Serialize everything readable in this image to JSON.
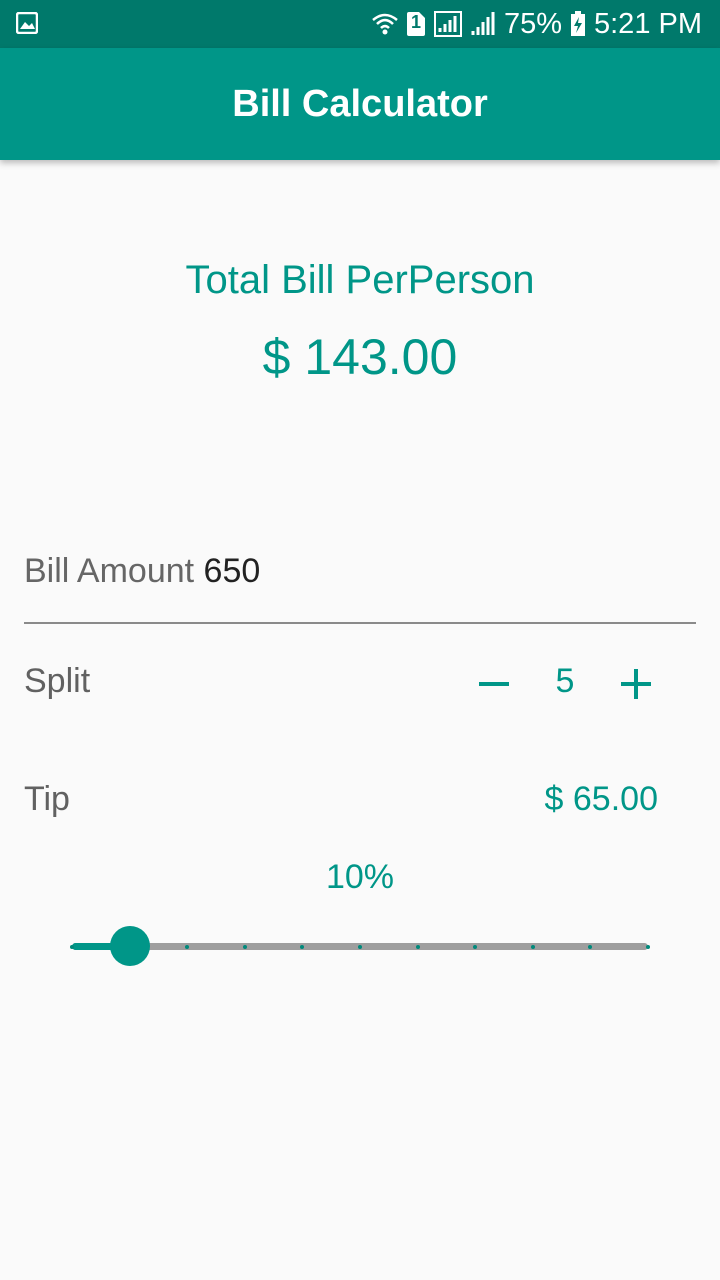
{
  "status_bar": {
    "battery_percent": "75%",
    "time": "5:21 PM",
    "sim_label": "1",
    "icons": [
      "gallery-notification-icon",
      "wifi-icon",
      "sim-icon",
      "signal-icon",
      "signal-icon",
      "battery-charging-icon"
    ]
  },
  "app_bar": {
    "title": "Bill Calculator"
  },
  "total": {
    "label": "Total Bill PerPerson",
    "value": "$ 143.00"
  },
  "bill": {
    "label": "Bill Amount",
    "value": "650"
  },
  "split": {
    "label": "Split",
    "value": "5",
    "decrement_icon": "minus-icon",
    "increment_icon": "plus-icon"
  },
  "tip": {
    "label": "Tip",
    "value": "$ 65.00",
    "percent_label": "10%"
  },
  "slider": {
    "value": 10,
    "min": 0,
    "max": 100,
    "divisions": 10
  },
  "colors": {
    "primary": "#009688",
    "primary_dark": "#00796b",
    "background": "#fafafa"
  }
}
